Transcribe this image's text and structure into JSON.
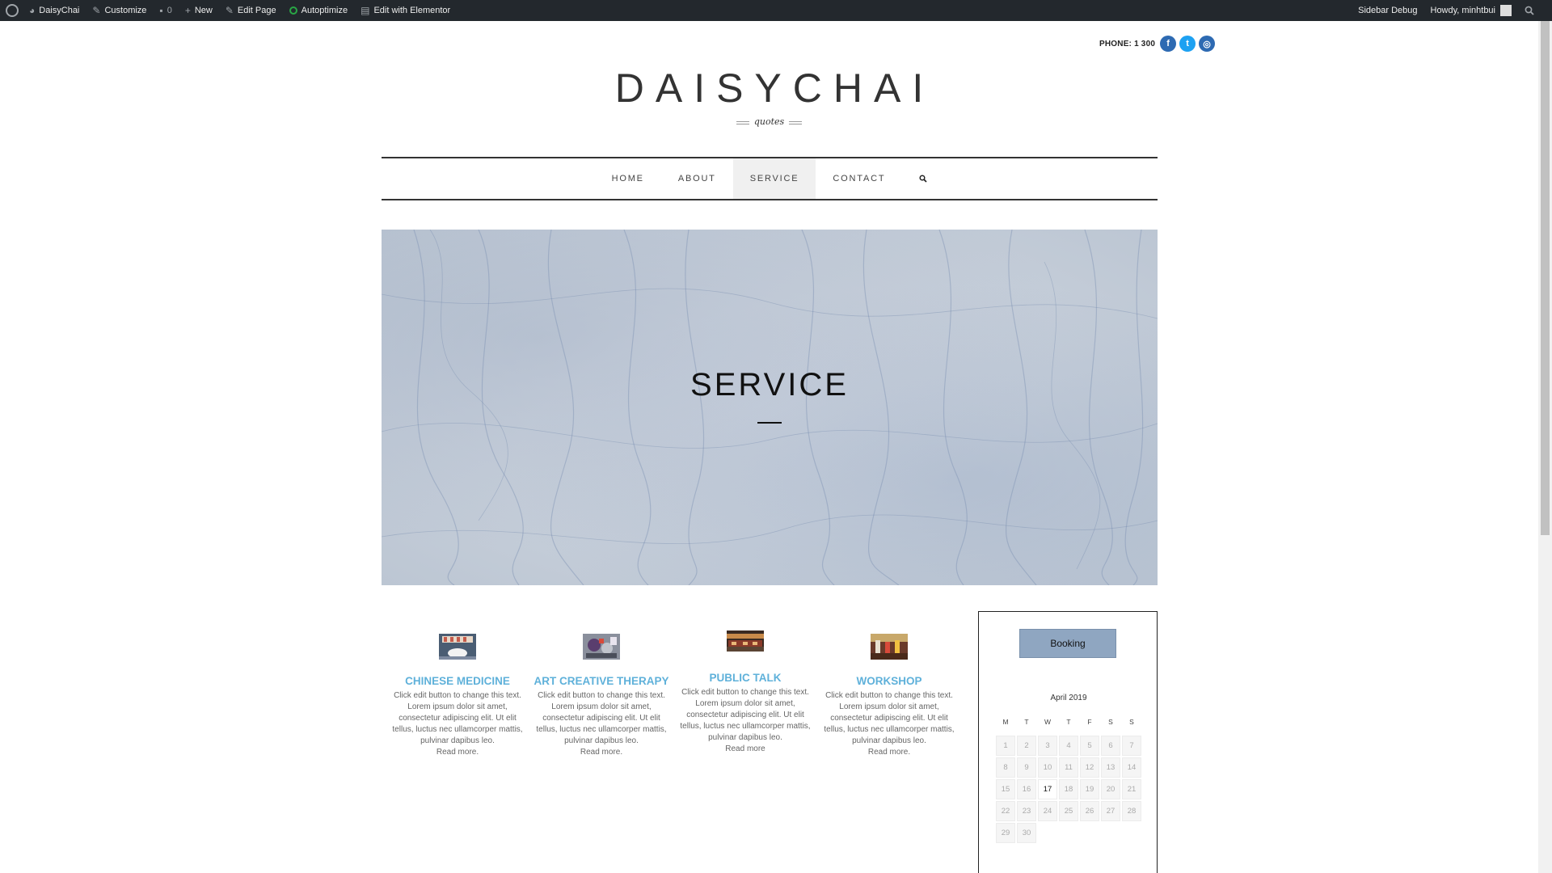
{
  "admin_bar": {
    "site_name": "DaisyChai",
    "customize": "Customize",
    "comments_count": "0",
    "new": "New",
    "edit_page": "Edit Page",
    "autoptimize": "Autoptimize",
    "edit_elementor": "Edit with Elementor",
    "sidebar_debug": "Sidebar Debug",
    "howdy": "Howdy, minhtbui"
  },
  "header": {
    "phone": "PHONE: 1 300",
    "social": [
      {
        "name": "facebook",
        "glyph": "f"
      },
      {
        "name": "twitter",
        "glyph": "t"
      },
      {
        "name": "instagram",
        "glyph": "◎"
      }
    ],
    "logo_title": "DAISYCHAI",
    "logo_subtitle": "quotes"
  },
  "nav": {
    "items": [
      {
        "label": "HOME",
        "active": false
      },
      {
        "label": "ABOUT",
        "active": false
      },
      {
        "label": "SERVICE",
        "active": true
      },
      {
        "label": "CONTACT",
        "active": false
      }
    ],
    "search_icon": "search-icon"
  },
  "hero": {
    "title": "SERVICE"
  },
  "services": [
    {
      "title": "CHINESE MEDICINE",
      "text": "Click edit button to change this text. Lorem ipsum dolor sit amet, consectetur adipiscing elit. Ut elit tellus, luctus nec ullamcorper mattis, pulvinar dapibus leo.",
      "read_more": "Read more."
    },
    {
      "title": "ART CREATIVE THERAPY",
      "text": "Click edit button to change this text. Lorem ipsum dolor sit amet, consectetur adipiscing elit. Ut elit tellus, luctus nec ullamcorper mattis, pulvinar dapibus leo.",
      "read_more": "Read more."
    },
    {
      "title": "PUBLIC TALK",
      "text": "Click edit button to change this text. Lorem ipsum dolor sit amet, consectetur adipiscing elit. Ut elit tellus, luctus nec ullamcorper mattis, pulvinar dapibus leo.",
      "read_more": "Read more"
    },
    {
      "title": "WORKSHOP",
      "text": "Click edit button to change this text. Lorem ipsum dolor sit amet, consectetur adipiscing elit. Ut elit tellus, luctus nec ullamcorper mattis, pulvinar dapibus leo.",
      "read_more": "Read more."
    }
  ],
  "booking": {
    "button_label": "Booking",
    "month": "April 2019",
    "weekdays": [
      "M",
      "T",
      "W",
      "T",
      "F",
      "S",
      "S"
    ],
    "days": [
      "1",
      "2",
      "3",
      "4",
      "5",
      "6",
      "7",
      "8",
      "9",
      "10",
      "11",
      "12",
      "13",
      "14",
      "15",
      "16",
      "17",
      "18",
      "19",
      "20",
      "21",
      "22",
      "23",
      "24",
      "25",
      "26",
      "27",
      "28",
      "29",
      "30"
    ],
    "today": "17"
  },
  "colors": {
    "admin_bar_bg": "#23282d",
    "service_title": "#5fb1da",
    "booking_button": "#8fa6c1",
    "social_icon": "#2d6ab2"
  }
}
